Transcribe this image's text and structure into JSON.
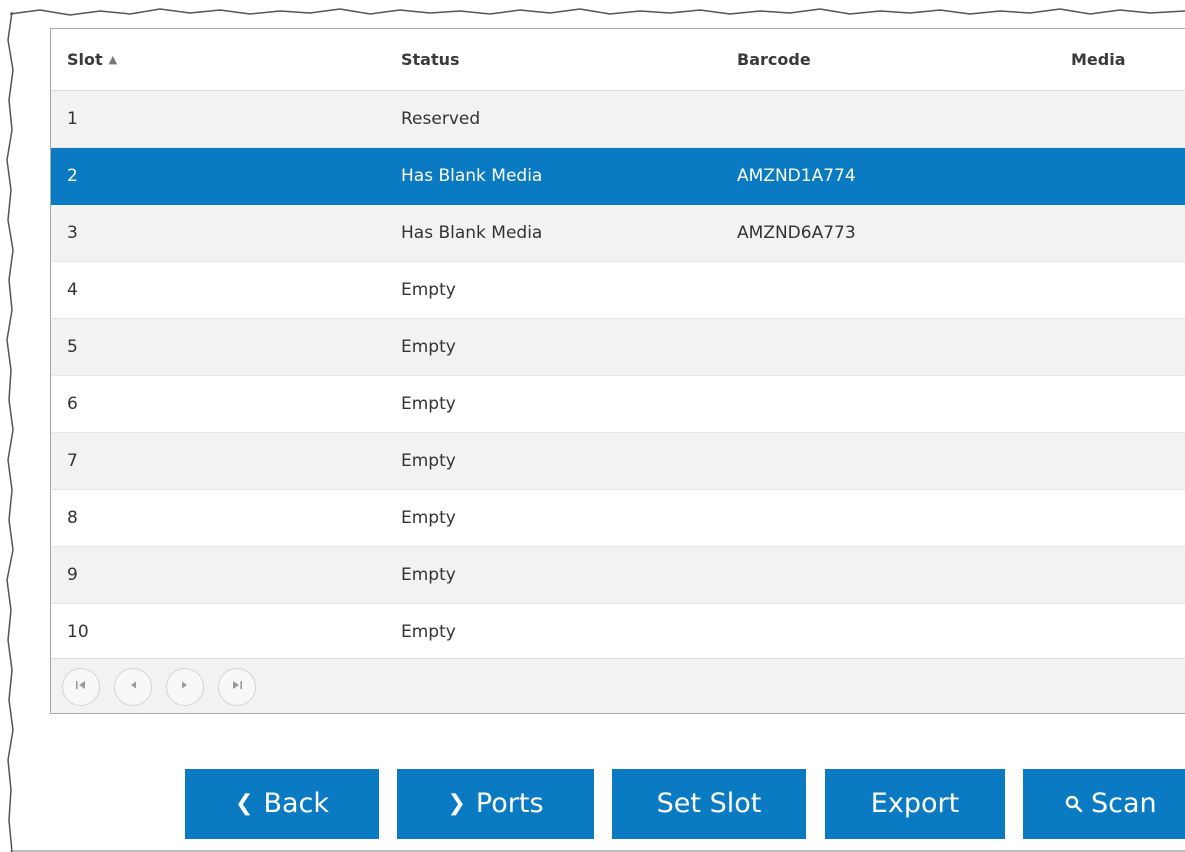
{
  "table": {
    "headers": [
      "Slot",
      "Status",
      "Barcode",
      "Media"
    ],
    "sort_indicator": "▲",
    "rows": [
      {
        "slot": "1",
        "status": "Reserved",
        "barcode": ""
      },
      {
        "slot": "2",
        "status": "Has Blank Media",
        "barcode": "AMZND1A774"
      },
      {
        "slot": "3",
        "status": "Has Blank Media",
        "barcode": "AMZND6A773"
      },
      {
        "slot": "4",
        "status": "Empty",
        "barcode": ""
      },
      {
        "slot": "5",
        "status": "Empty",
        "barcode": ""
      },
      {
        "slot": "6",
        "status": "Empty",
        "barcode": ""
      },
      {
        "slot": "7",
        "status": "Empty",
        "barcode": ""
      },
      {
        "slot": "8",
        "status": "Empty",
        "barcode": ""
      },
      {
        "slot": "9",
        "status": "Empty",
        "barcode": ""
      },
      {
        "slot": "10",
        "status": "Empty",
        "barcode": ""
      }
    ]
  },
  "pager": {
    "first_icon": "first-page-icon",
    "prev_icon": "previous-page-icon",
    "next_icon": "next-page-icon",
    "last_icon": "last-page-icon"
  },
  "actions": {
    "back_label": "Back",
    "back_icon": "chevron-left-icon",
    "ports_label": "Ports",
    "ports_icon": "chevron-right-icon",
    "set_slot_label": "Set Slot",
    "export_label": "Export",
    "scan_label": "Scan",
    "scan_icon": "search-icon"
  },
  "colors": {
    "accent": "#0a7bc2",
    "row_alt": "#f2f2f2"
  }
}
